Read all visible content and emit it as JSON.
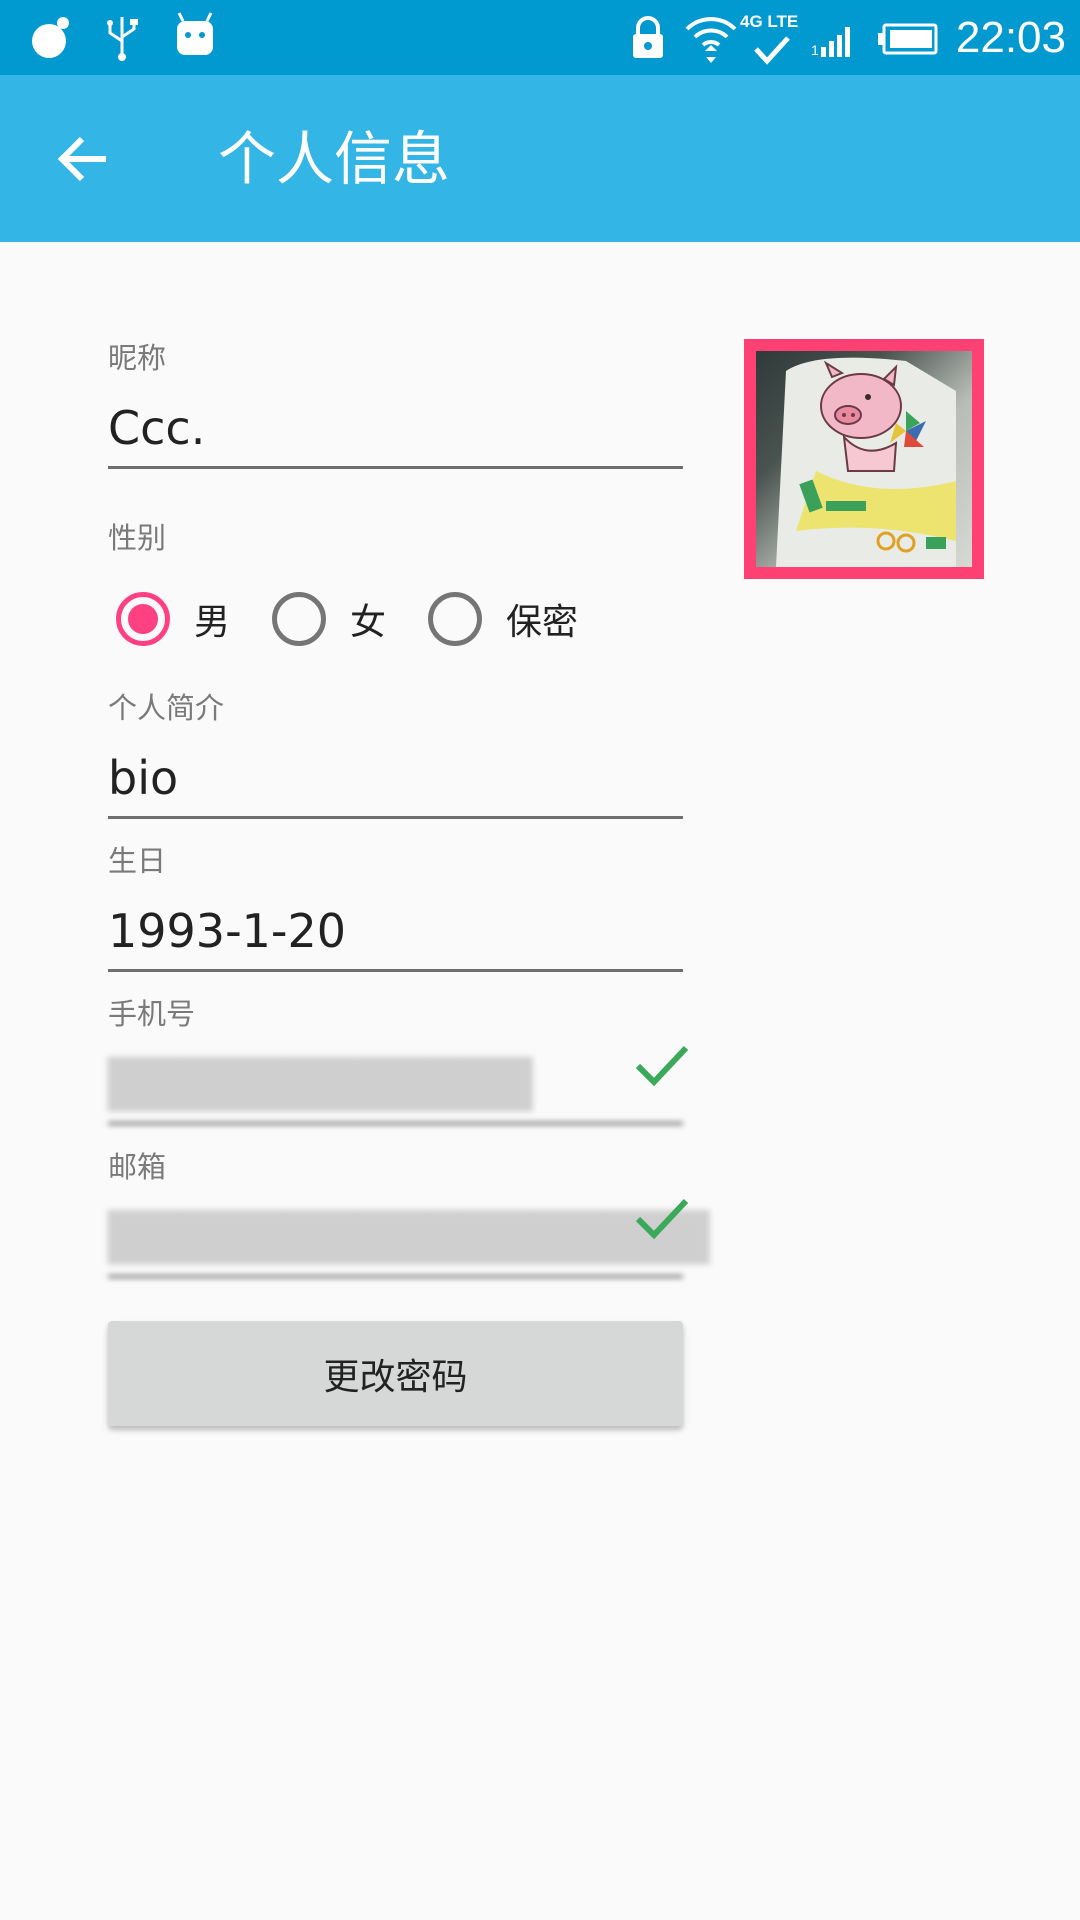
{
  "status_bar": {
    "time": "22:03",
    "network_label": "4G LTE",
    "icons": [
      "app-notification-icon",
      "usb-icon",
      "android-debug-icon",
      "lock-icon",
      "wifi-icon",
      "signal-icon",
      "battery-icon"
    ]
  },
  "app_bar": {
    "back_icon": "arrow-left-icon",
    "title": "个人信息"
  },
  "form": {
    "nickname": {
      "label": "昵称",
      "value": "Ccc."
    },
    "gender": {
      "label": "性别",
      "options": [
        {
          "label": "男",
          "checked": true
        },
        {
          "label": "女",
          "checked": false
        },
        {
          "label": "保密",
          "checked": false
        }
      ]
    },
    "bio": {
      "label": "个人简介",
      "value": "bio"
    },
    "birthday": {
      "label": "生日",
      "value": "1993-1-20"
    },
    "phone": {
      "label": "手机号",
      "value": "████████████",
      "verified": true
    },
    "email": {
      "label": "邮箱",
      "value": "█████████████████",
      "verified": true
    },
    "change_password_label": "更改密码"
  },
  "colors": {
    "status_bar": "#0099d0",
    "app_bar": "#33b5e5",
    "accent": "#ff4081",
    "avatar_border": "#ff4073",
    "check": "#3aaa5a",
    "button_bg": "#d6d7d7"
  }
}
